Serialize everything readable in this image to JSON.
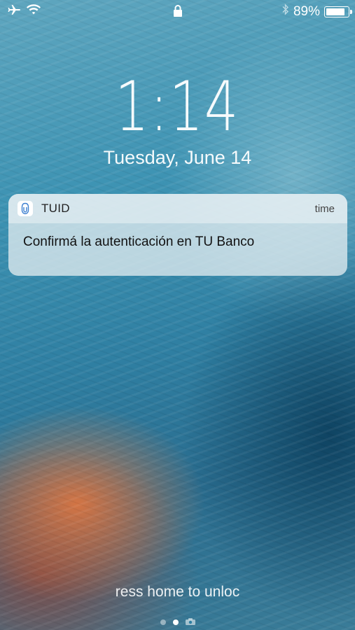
{
  "status_bar": {
    "battery_percent": "89%",
    "battery_level": 0.89
  },
  "lock_screen": {
    "time": "1:14",
    "date": "Tuesday, June 14"
  },
  "notification": {
    "app_name": "TUID",
    "time_label": "time",
    "message": "Confirmá la autenticación en TU Banco"
  },
  "unlock_hint": "ress home to unloc"
}
